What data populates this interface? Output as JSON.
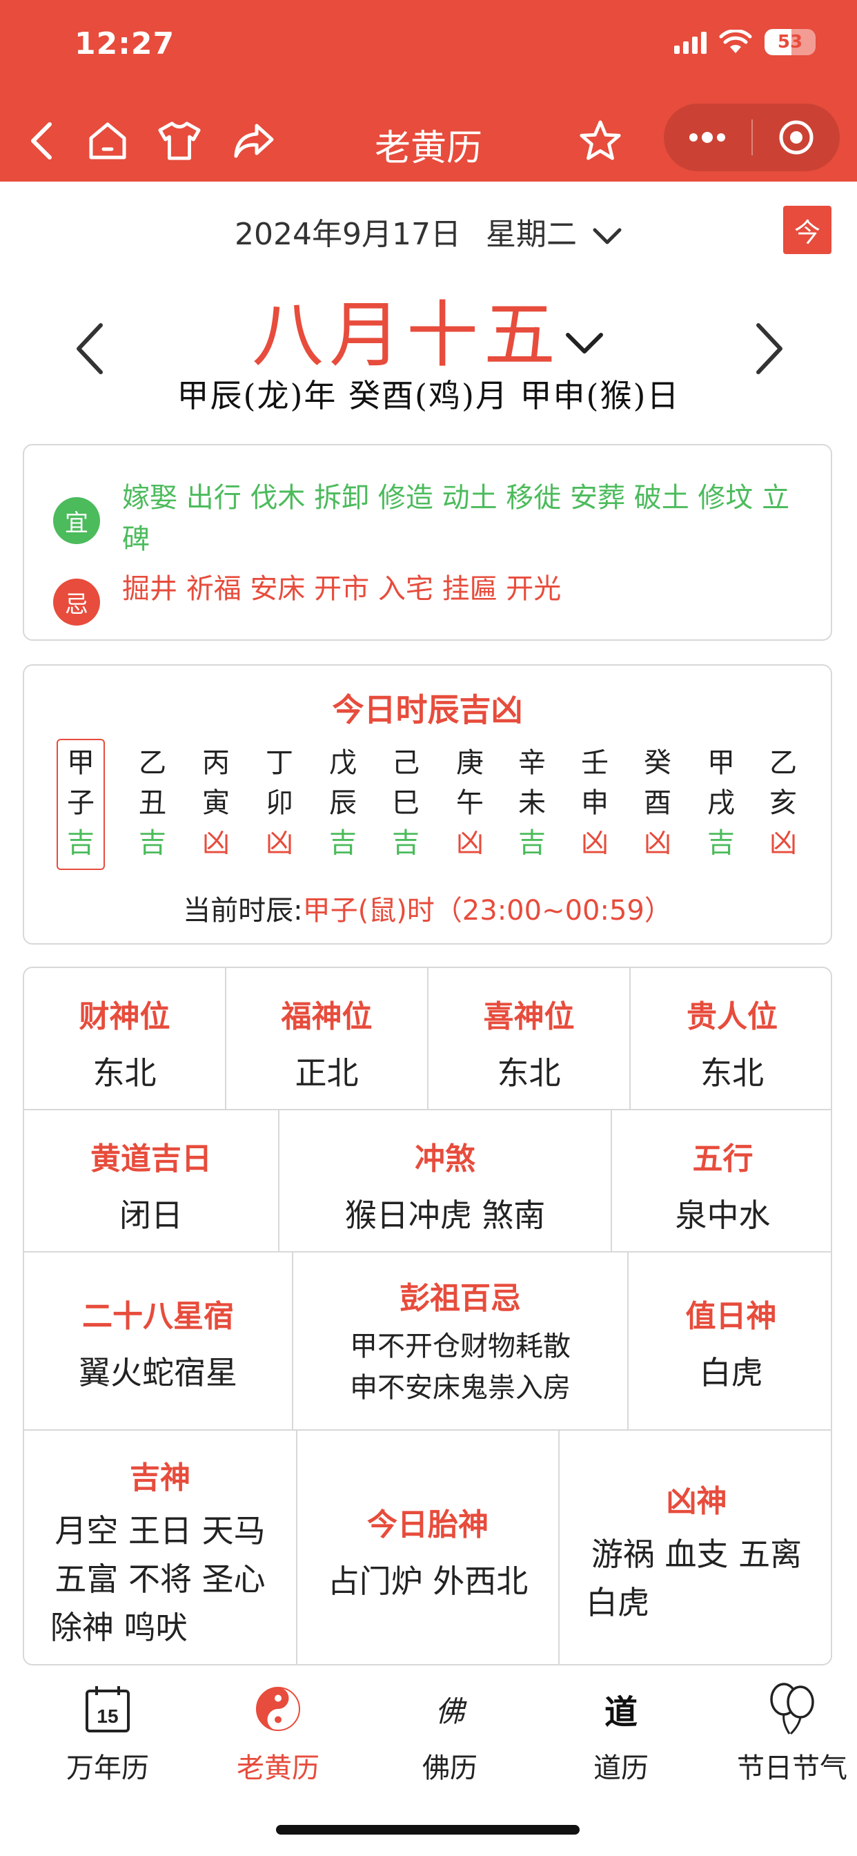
{
  "status_bar": {
    "time": "12:27",
    "battery": "53"
  },
  "navbar": {
    "title": "老黄历"
  },
  "date": {
    "solar": "2024年9月17日",
    "weekday": "星期二",
    "today_button": "今",
    "lunar": "八月十五",
    "ganzhi": "甲辰(龙)年 癸酉(鸡)月 甲申(猴)日"
  },
  "yiji": {
    "yi_label": "宜",
    "yi_items": "嫁娶 出行 伐木 拆卸 修造 动土 移徙 安葬 破土 修坟 立碑",
    "ji_label": "忌",
    "ji_items": "掘井 祈福 安床 开市 入宅 挂匾 开光"
  },
  "hours": {
    "title": "今日时辰吉凶",
    "columns": [
      {
        "stem": "甲",
        "branch": "子",
        "luck": "吉",
        "current": true
      },
      {
        "stem": "乙",
        "branch": "丑",
        "luck": "吉"
      },
      {
        "stem": "丙",
        "branch": "寅",
        "luck": "凶"
      },
      {
        "stem": "丁",
        "branch": "卯",
        "luck": "凶"
      },
      {
        "stem": "戊",
        "branch": "辰",
        "luck": "吉"
      },
      {
        "stem": "己",
        "branch": "巳",
        "luck": "吉"
      },
      {
        "stem": "庚",
        "branch": "午",
        "luck": "凶"
      },
      {
        "stem": "辛",
        "branch": "未",
        "luck": "吉"
      },
      {
        "stem": "壬",
        "branch": "申",
        "luck": "凶"
      },
      {
        "stem": "癸",
        "branch": "酉",
        "luck": "凶"
      },
      {
        "stem": "甲",
        "branch": "戌",
        "luck": "吉"
      },
      {
        "stem": "乙",
        "branch": "亥",
        "luck": "凶"
      }
    ],
    "current_label": "当前时辰:",
    "current_value": "甲子(鼠)时（23:00~00:59）"
  },
  "info": {
    "caishen": {
      "title": "财神位",
      "value": "东北"
    },
    "fushen": {
      "title": "福神位",
      "value": "正北"
    },
    "xishen": {
      "title": "喜神位",
      "value": "东北"
    },
    "guiren": {
      "title": "贵人位",
      "value": "东北"
    },
    "huangdao": {
      "title": "黄道吉日",
      "value": "闭日"
    },
    "chongsha": {
      "title": "冲煞",
      "value": "猴日冲虎 煞南"
    },
    "wuxing": {
      "title": "五行",
      "value": "泉中水"
    },
    "xingsu": {
      "title": "二十八星宿",
      "value": "翼火蛇宿星"
    },
    "pengzu": {
      "title": "彭祖百忌",
      "line1": "甲不开仓财物耗散",
      "line2": "申不安床鬼祟入房"
    },
    "zhishen": {
      "title": "值日神",
      "value": "白虎"
    },
    "jishen": {
      "title": "吉神",
      "line1": "月空 王日 天马",
      "line2": "五富 不将 圣心",
      "line3": "除神 鸣吠"
    },
    "taishen": {
      "title": "今日胎神",
      "value": "占门炉 外西北"
    },
    "xiongshen": {
      "title": "凶神",
      "line1": "游祸 血支 五离",
      "line2": "白虎"
    }
  },
  "tabs": [
    {
      "label": "万年历",
      "icon": "calendar-icon",
      "icon_text": "15"
    },
    {
      "label": "老黄历",
      "icon": "yin-yang-icon",
      "active": true
    },
    {
      "label": "佛历",
      "icon": "buddha-icon",
      "icon_text": "佛"
    },
    {
      "label": "道历",
      "icon": "tao-icon",
      "icon_text": "道"
    },
    {
      "label": "节日节气",
      "icon": "balloon-icon"
    }
  ],
  "colors": {
    "accent": "#e74c3c",
    "good": "#4cbb5c",
    "border": "#d8d8d8"
  }
}
